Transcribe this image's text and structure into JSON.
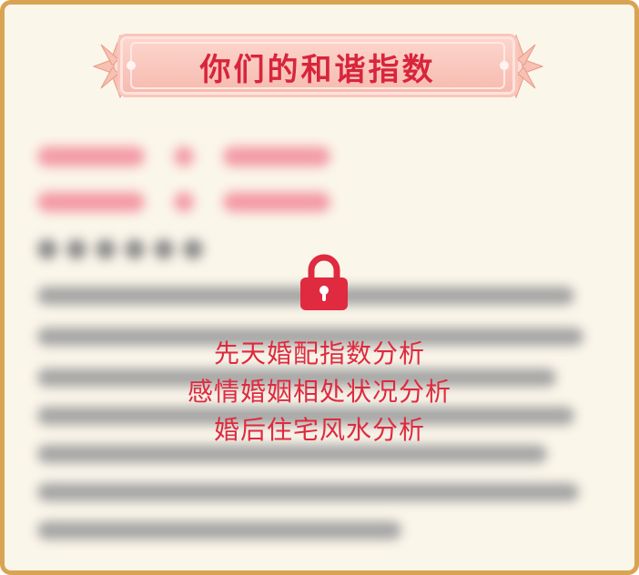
{
  "title": "你们的和谐指数",
  "locked_features": [
    "先天婚配指数分析",
    "感情婚姻相处状况分析",
    "婚后住宅风水分析"
  ],
  "colors": {
    "accent": "#df2a3f",
    "border": "#d9a452",
    "background": "#fbf6ea",
    "banner": "#f6b8ad"
  },
  "icons": [
    "lock-icon",
    "flower-ornament-icon"
  ]
}
